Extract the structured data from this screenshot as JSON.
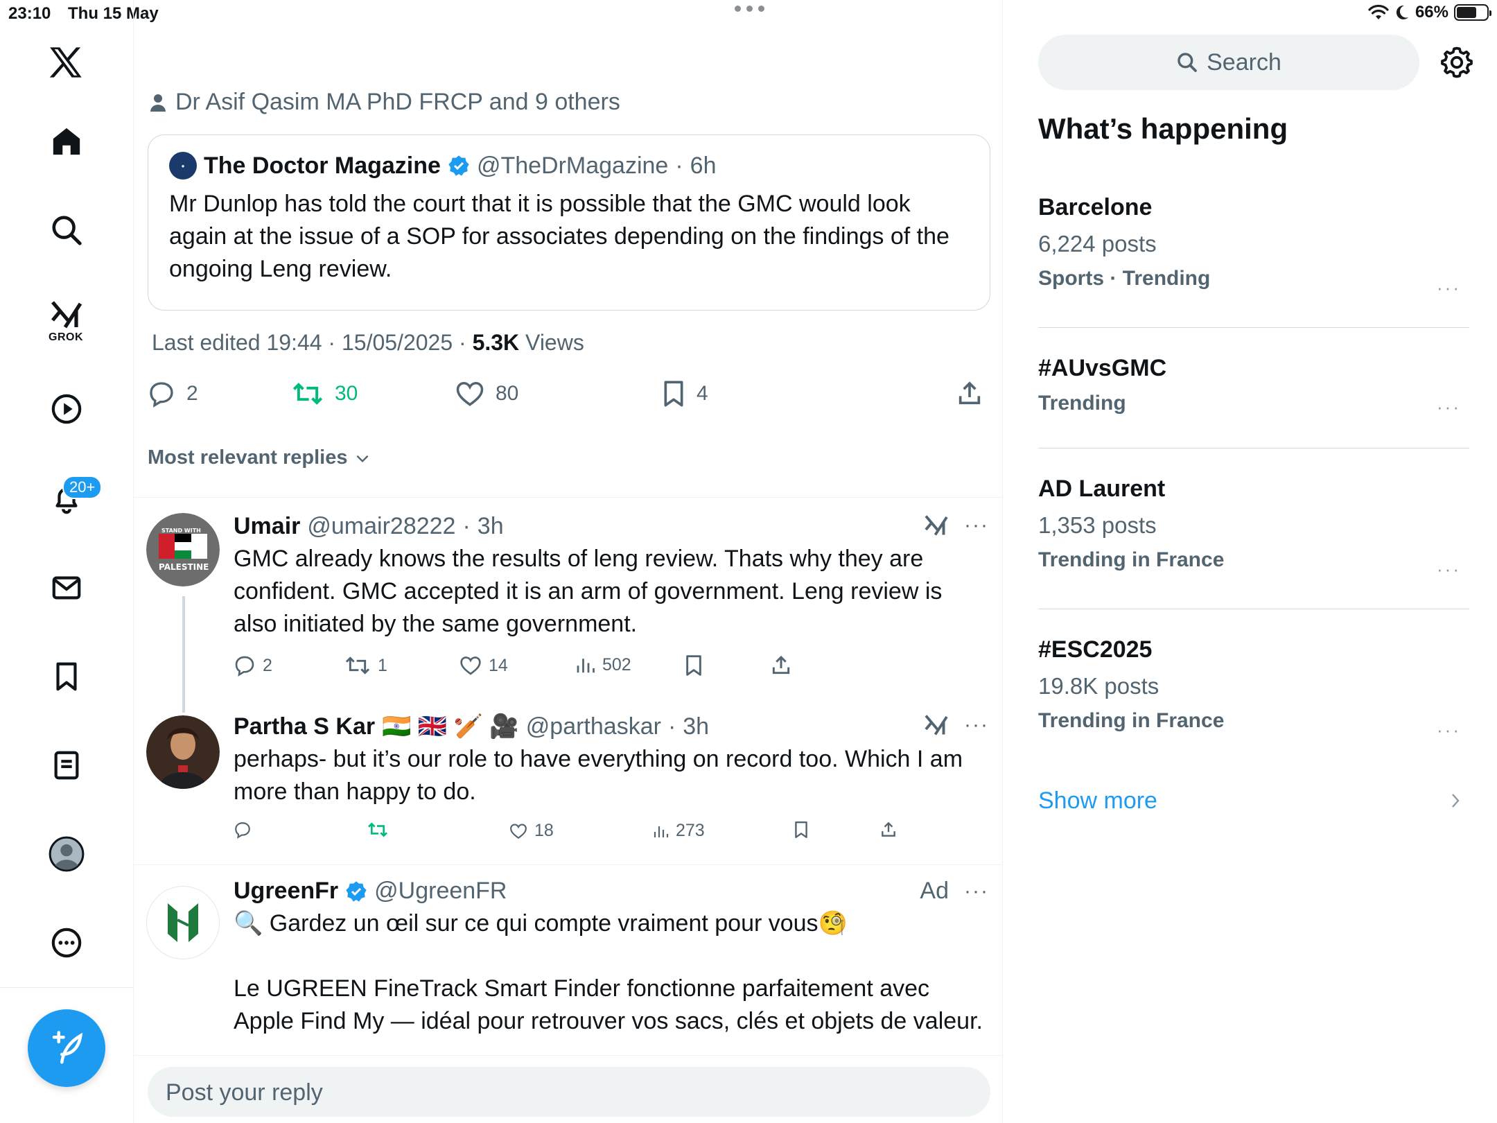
{
  "status_bar": {
    "time": "23:10",
    "date": "Thu 15 May",
    "battery": "66%",
    "battery_level": 0.66
  },
  "nav": {
    "grok_label": "GROK",
    "notifications_badge": "20+"
  },
  "tweet": {
    "liked_by": "Dr Asif Qasim MA PhD FRCP and 9 others",
    "quote": {
      "name": "The Doctor Magazine",
      "handle": "@TheDrMagazine",
      "time": "6h",
      "text": "Mr Dunlop has told the court that it is possible that the GMC would look again at the issue of a SOP for associates depending on the findings of the ongoing Leng review."
    },
    "last_edited": "Last edited 19:44 · 15/05/2025",
    "views_count": "5.3K",
    "views_label": "Views",
    "replies": "2",
    "reposts": "30",
    "likes": "80",
    "bookmarks": "4",
    "sort_label": "Most relevant replies"
  },
  "replies": [
    {
      "name": "Umair",
      "handle": "@umair28222",
      "time": "3h",
      "text": "GMC already knows the results of leng review. Thats why they are confident. GMC accepted it is an arm of government. Leng review is also initiated by the same government.",
      "replies": "2",
      "reposts": "1",
      "likes": "14",
      "views": "502",
      "avatar_text_top": "STAND WITH",
      "avatar_text_bottom": "PALESTINE"
    },
    {
      "name": "Partha S Kar",
      "flags": "🇮🇳 🇬🇧 🏏 🎥",
      "handle": "@parthaskar",
      "time": "3h",
      "text": "perhaps- but it’s our role to have everything on record too. Which I am more than happy to do.",
      "likes": "18",
      "views": "273"
    },
    {
      "name": "UgreenFr",
      "handle": "@UgreenFR",
      "ad_label": "Ad",
      "line1": "🔍 Gardez un œil sur ce qui compte vraiment pour vous🧐",
      "line2": "Le UGREEN FineTrack Smart Finder fonctionne parfaitement avec Apple Find My — idéal pour retrouver vos sacs, clés et objets de valeur."
    }
  ],
  "reply_placeholder": "Post your reply",
  "sidebar": {
    "search_placeholder": "Search",
    "title": "What’s happening",
    "trends": [
      {
        "name": "Barcelone",
        "count": "6,224 posts",
        "category": "Sports · Trending"
      },
      {
        "name": "#AUvsGMC",
        "category": "Trending"
      },
      {
        "name": "AD Laurent",
        "count": "1,353 posts",
        "category": "Trending in France"
      },
      {
        "name": "#ESC2025",
        "count": "19.8K posts",
        "category": "Trending in France"
      }
    ],
    "show_more": "Show more"
  },
  "colors": {
    "accent": "#1d9bf0",
    "repost_green": "#00ba7c",
    "muted": "#536471"
  }
}
